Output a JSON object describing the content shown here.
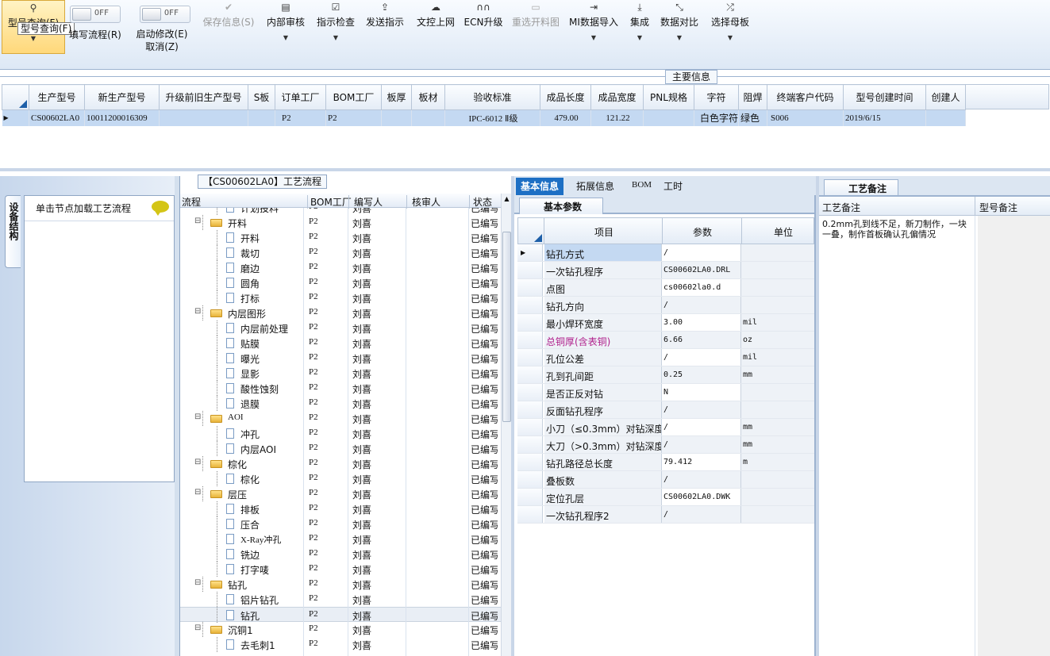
{
  "toolbar": {
    "search_btn": {
      "label": "型号查询(F)",
      "tooltip": "型号查询(F)"
    },
    "write_flow": {
      "label": "填写流程(R)",
      "toggle": "OFF"
    },
    "enable_edit": {
      "label": "启动修改(E)",
      "sub": "取消(Z)",
      "toggle": "OFF"
    },
    "save": "保存信息(S)",
    "buttons": [
      "内部审核",
      "指示检查",
      "发送指示",
      "文控上网",
      "ECN升级",
      "重选开料图",
      "MI数据导入",
      "集成",
      "数据对比",
      "选择母板"
    ]
  },
  "main_info": {
    "section_label": "主要信息",
    "columns": [
      "生产型号",
      "新生产型号",
      "升级前旧生产型号",
      "S板",
      "订单工厂",
      "BOM工厂",
      "板厚",
      "板材",
      "验收标准",
      "成品长度",
      "成品宽度",
      "PNL规格",
      "字符",
      "阻焊",
      "终端客户代码",
      "型号创建时间",
      "创建人"
    ],
    "row": [
      "CS00602LA0",
      "10011200016309",
      "",
      "",
      "P2",
      "P2",
      "",
      "",
      "IPC-6012 Ⅱ级",
      "479.00",
      "121.22",
      "",
      "白色字符",
      "绿色",
      "S006",
      "2019/6/15",
      ""
    ]
  },
  "left_panel": {
    "vertical_tab": "设备结构",
    "hint": "单击节点加载工艺流程"
  },
  "flow_panel": {
    "title": "【CS00602LA0】工艺流程",
    "columns": [
      "流程",
      "BOM工厂",
      "编写人",
      "核审人",
      "状态"
    ],
    "rows": [
      {
        "name": "计划投料",
        "level": 1,
        "folder": false,
        "factory": "P2",
        "writer": "刘喜",
        "status": "已编写"
      },
      {
        "name": "开料",
        "level": 0,
        "folder": true,
        "factory": "P2",
        "writer": "刘喜",
        "status": "已编写"
      },
      {
        "name": "开料",
        "level": 1,
        "folder": false,
        "factory": "P2",
        "writer": "刘喜",
        "status": "已编写"
      },
      {
        "name": "裁切",
        "level": 1,
        "folder": false,
        "factory": "P2",
        "writer": "刘喜",
        "status": "已编写"
      },
      {
        "name": "磨边",
        "level": 1,
        "folder": false,
        "factory": "P2",
        "writer": "刘喜",
        "status": "已编写"
      },
      {
        "name": "圆角",
        "level": 1,
        "folder": false,
        "factory": "P2",
        "writer": "刘喜",
        "status": "已编写"
      },
      {
        "name": "打标",
        "level": 1,
        "folder": false,
        "factory": "P2",
        "writer": "刘喜",
        "status": "已编写"
      },
      {
        "name": "内层图形",
        "level": 0,
        "folder": true,
        "factory": "P2",
        "writer": "刘喜",
        "status": "已编写"
      },
      {
        "name": "内层前处理",
        "level": 1,
        "folder": false,
        "factory": "P2",
        "writer": "刘喜",
        "status": "已编写"
      },
      {
        "name": "贴膜",
        "level": 1,
        "folder": false,
        "factory": "P2",
        "writer": "刘喜",
        "status": "已编写"
      },
      {
        "name": "曝光",
        "level": 1,
        "folder": false,
        "factory": "P2",
        "writer": "刘喜",
        "status": "已编写"
      },
      {
        "name": "显影",
        "level": 1,
        "folder": false,
        "factory": "P2",
        "writer": "刘喜",
        "status": "已编写"
      },
      {
        "name": "酸性蚀刻",
        "level": 1,
        "folder": false,
        "factory": "P2",
        "writer": "刘喜",
        "status": "已编写"
      },
      {
        "name": "退膜",
        "level": 1,
        "folder": false,
        "factory": "P2",
        "writer": "刘喜",
        "status": "已编写"
      },
      {
        "name": "AOI",
        "level": 0,
        "folder": true,
        "factory": "P2",
        "writer": "刘喜",
        "status": "已编写"
      },
      {
        "name": "冲孔",
        "level": 1,
        "folder": false,
        "factory": "P2",
        "writer": "刘喜",
        "status": "已编写"
      },
      {
        "name": "内层AOI",
        "level": 1,
        "folder": false,
        "factory": "P2",
        "writer": "刘喜",
        "status": "已编写"
      },
      {
        "name": "棕化",
        "level": 0,
        "folder": true,
        "factory": "P2",
        "writer": "刘喜",
        "status": "已编写"
      },
      {
        "name": "棕化",
        "level": 1,
        "folder": false,
        "factory": "P2",
        "writer": "刘喜",
        "status": "已编写"
      },
      {
        "name": "层压",
        "level": 0,
        "folder": true,
        "factory": "P2",
        "writer": "刘喜",
        "status": "已编写"
      },
      {
        "name": "排板",
        "level": 1,
        "folder": false,
        "factory": "P2",
        "writer": "刘喜",
        "status": "已编写"
      },
      {
        "name": "压合",
        "level": 1,
        "folder": false,
        "factory": "P2",
        "writer": "刘喜",
        "status": "已编写"
      },
      {
        "name": "X-Ray冲孔",
        "level": 1,
        "folder": false,
        "factory": "P2",
        "writer": "刘喜",
        "status": "已编写"
      },
      {
        "name": "铣边",
        "level": 1,
        "folder": false,
        "factory": "P2",
        "writer": "刘喜",
        "status": "已编写"
      },
      {
        "name": "打字唛",
        "level": 1,
        "folder": false,
        "factory": "P2",
        "writer": "刘喜",
        "status": "已编写"
      },
      {
        "name": "钻孔",
        "level": 0,
        "folder": true,
        "factory": "P2",
        "writer": "刘喜",
        "status": "已编写"
      },
      {
        "name": "铝片钻孔",
        "level": 1,
        "folder": false,
        "factory": "P2",
        "writer": "刘喜",
        "status": "已编写"
      },
      {
        "name": "钻孔",
        "level": 1,
        "folder": false,
        "factory": "P2",
        "writer": "刘喜",
        "status": "已编写",
        "selected": true
      },
      {
        "name": "沉铜1",
        "level": 0,
        "folder": true,
        "factory": "P2",
        "writer": "刘喜",
        "status": "已编写"
      },
      {
        "name": "去毛刺1",
        "level": 1,
        "folder": false,
        "factory": "P2",
        "writer": "刘喜",
        "status": "已编写"
      }
    ]
  },
  "detail_panel": {
    "tabs": [
      "基本信息",
      "拓展信息",
      "BOM",
      "工时"
    ],
    "subtab": "基本参数",
    "columns": [
      "项目",
      "参数",
      "单位"
    ],
    "rows": [
      {
        "item": "钻孔方式",
        "value": "/",
        "unit": ""
      },
      {
        "item": "一次钻孔程序",
        "value": "CS00602LA0.DRL",
        "unit": ""
      },
      {
        "item": "点图",
        "value": "cs00602la0.d",
        "unit": ""
      },
      {
        "item": "钻孔方向",
        "value": "/",
        "unit": ""
      },
      {
        "item": "最小焊环宽度",
        "value": "3.00",
        "unit": "mil"
      },
      {
        "item": "总铜厚(含表铜)",
        "value": "6.66",
        "unit": "oz",
        "highlight": true
      },
      {
        "item": "孔位公差",
        "value": "/",
        "unit": "mil"
      },
      {
        "item": "孔到孔间距",
        "value": "0.25",
        "unit": "mm"
      },
      {
        "item": "是否正反对钻",
        "value": "N",
        "unit": ""
      },
      {
        "item": "反面钻孔程序",
        "value": "/",
        "unit": ""
      },
      {
        "item": "小刀（≤0.3mm）对钻深度",
        "value": "/",
        "unit": "mm"
      },
      {
        "item": "大刀（>0.3mm）对钻深度",
        "value": "/",
        "unit": "mm"
      },
      {
        "item": "钻孔路径总长度",
        "value": "79.412",
        "unit": "m"
      },
      {
        "item": "叠板数",
        "value": "/",
        "unit": ""
      },
      {
        "item": "定位孔层",
        "value": "CS00602LA0.DWK",
        "unit": ""
      },
      {
        "item": "一次钻孔程序2",
        "value": "/",
        "unit": ""
      }
    ]
  },
  "note_panel": {
    "tab": "工艺备注",
    "col1": "工艺备注",
    "col2": "型号备注",
    "note": "0.2mm孔到线不足，新刀制作，一块一叠，制作首板确认孔偏情况"
  },
  "colors": {
    "accent": "#1d6fc4",
    "selected_row": "#c4d9f2",
    "highlight_text": "#b0208c"
  }
}
